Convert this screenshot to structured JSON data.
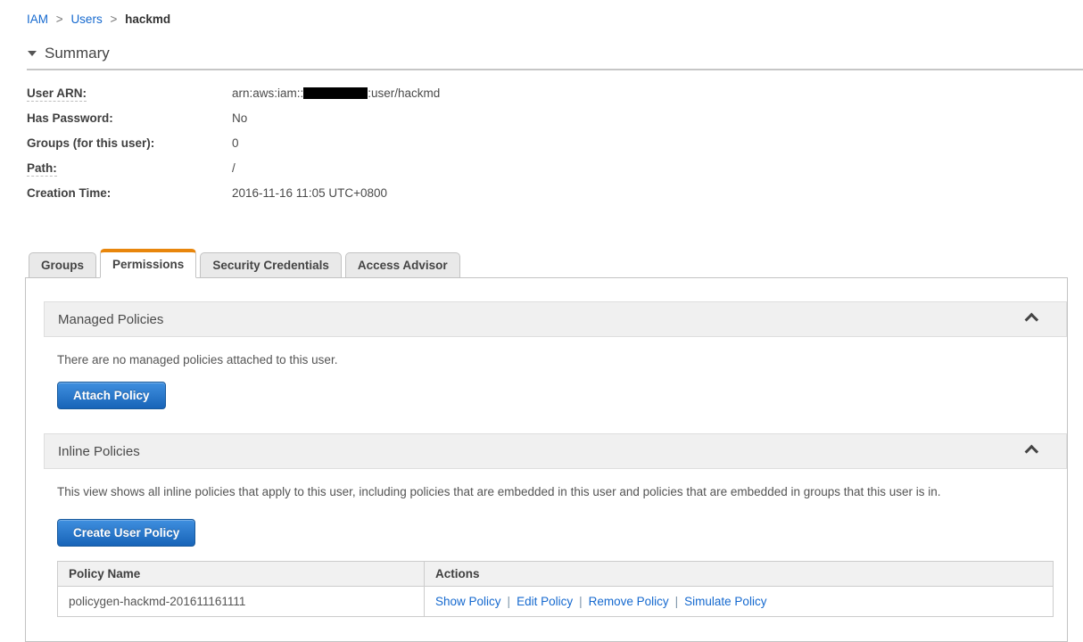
{
  "breadcrumb": {
    "separator": ">",
    "items": [
      {
        "label": "IAM"
      },
      {
        "label": "Users"
      },
      {
        "label": "hackmd"
      }
    ]
  },
  "summary": {
    "title": "Summary",
    "fields": [
      {
        "label": "User ARN:",
        "value_prefix": "arn:aws:iam::",
        "value_redacted": true,
        "value_suffix": ":user/hackmd"
      },
      {
        "label": "Has Password:",
        "value": "No"
      },
      {
        "label": "Groups (for this user):",
        "value": "0"
      },
      {
        "label": "Path:",
        "value": "/"
      },
      {
        "label": "Creation Time:",
        "value": "2016-11-16 11:05 UTC+0800"
      }
    ]
  },
  "tabs": [
    {
      "label": "Groups",
      "active": false
    },
    {
      "label": "Permissions",
      "active": true
    },
    {
      "label": "Security Credentials",
      "active": false
    },
    {
      "label": "Access Advisor",
      "active": false
    }
  ],
  "managed_policies": {
    "title": "Managed Policies",
    "empty_message": "There are no managed policies attached to this user.",
    "attach_button": "Attach Policy"
  },
  "inline_policies": {
    "title": "Inline Policies",
    "description": "This view shows all inline policies that apply to this user, including policies that are embedded in this user and policies that are embedded in groups that this user is in.",
    "create_button": "Create User Policy",
    "table": {
      "headers": [
        "Policy Name",
        "Actions"
      ],
      "action_separator": "|",
      "rows": [
        {
          "policy_name": "policygen-hackmd-201611161111",
          "actions": [
            "Show Policy",
            "Edit Policy",
            "Remove Policy",
            "Simulate Policy"
          ]
        }
      ]
    }
  },
  "colors": {
    "link_blue": "#1569cf",
    "tab_accent_orange": "#e8860c",
    "button_blue_top": "#3f8fdf",
    "button_blue_bottom": "#1864b8",
    "section_header_bg": "#f0f0f0",
    "redaction": "#000000"
  }
}
